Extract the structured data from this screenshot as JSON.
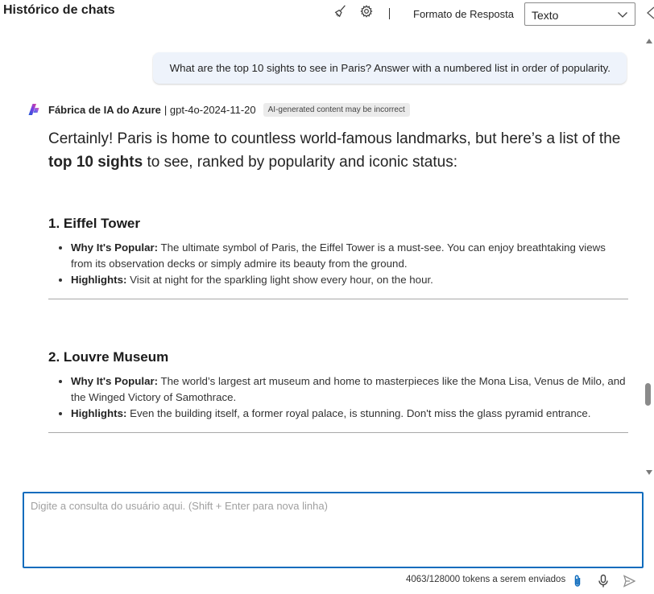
{
  "header": {
    "title": "Histórico de chats",
    "clear_icon": "broom-icon",
    "settings_icon": "gear-icon",
    "format_label": "Formato de Resposta",
    "format_value": "Texto"
  },
  "user_message": "What are the top 10 sights to see in Paris? Answer with a numbered list in order of popularity.",
  "assistant": {
    "name": "Fábrica de IA do Azure",
    "model": "| gpt-4o-2024-11-20",
    "badge": "AI-generated content may be incorrect",
    "intro_prefix": "Certainly! Paris is home to countless world-famous landmarks, but here’s a list of the ",
    "intro_bold": "top 10 sights",
    "intro_suffix": " to see, ranked by popularity and iconic status:",
    "sights": [
      {
        "title": "1. Eiffel Tower",
        "why_label": "Why It's Popular:",
        "why_text": " The ultimate symbol of Paris, the Eiffel Tower is a must-see. You can enjoy breathtaking views from its observation decks or simply admire its beauty from the ground.",
        "highlights_label": "Highlights:",
        "highlights_text": " Visit at night for the sparkling light show every hour, on the hour."
      },
      {
        "title": "2. Louvre Museum",
        "why_label": "Why It's Popular:",
        "why_text": " The world’s largest art museum and home to masterpieces like the Mona Lisa, Venus de Milo, and the Winged Victory of Samothrace.",
        "highlights_label": "Highlights:",
        "highlights_text": " Even the building itself, a former royal palace, is stunning. Don't miss the glass pyramid entrance."
      }
    ]
  },
  "input": {
    "placeholder": "Digite a consulta do usuário aqui. (Shift + Enter para nova linha)"
  },
  "footer": {
    "tokens": "4063/128000 tokens a serem enviados",
    "attach_icon": "paperclip-icon",
    "mic_icon": "microphone-icon",
    "send_icon": "send-icon"
  },
  "colors": {
    "accent": "#0f6cbd",
    "bubble": "#eef3fb"
  }
}
